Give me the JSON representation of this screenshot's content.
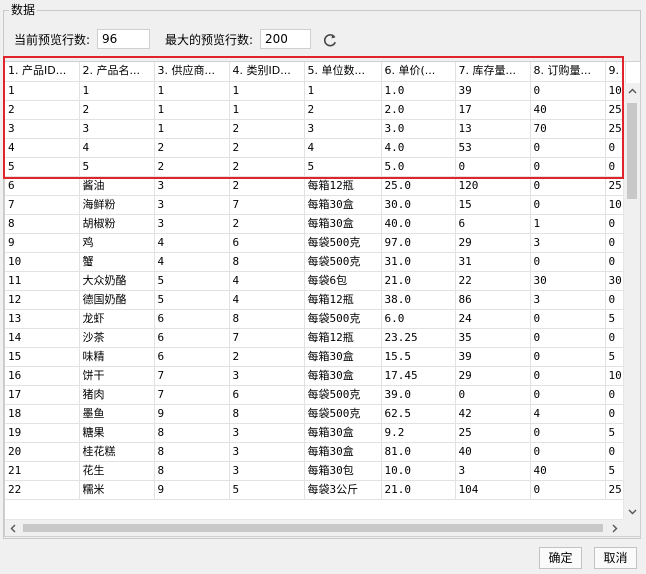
{
  "group": {
    "title": "数据"
  },
  "preview": {
    "current_label": "当前预览行数:",
    "current_value": "96",
    "max_label": "最大的预览行数:",
    "max_value": "200",
    "refresh_icon": "refresh-icon"
  },
  "table": {
    "columns": [
      "1. 产品ID...",
      "2. 产品名...",
      "3. 供应商...",
      "4. 类别ID...",
      "5. 单位数...",
      "6. 单价(...",
      "7. 库存量...",
      "8. 订购量...",
      "9."
    ],
    "rows": [
      [
        "1",
        "1",
        "1",
        "1",
        "1",
        "1.0",
        "39",
        "0",
        "10"
      ],
      [
        "2",
        "2",
        "1",
        "1",
        "2",
        "2.0",
        "17",
        "40",
        "25"
      ],
      [
        "3",
        "3",
        "1",
        "2",
        "3",
        "3.0",
        "13",
        "70",
        "25"
      ],
      [
        "4",
        "4",
        "2",
        "2",
        "4",
        "4.0",
        "53",
        "0",
        "0"
      ],
      [
        "5",
        "5",
        "2",
        "2",
        "5",
        "5.0",
        "0",
        "0",
        "0"
      ],
      [
        "6",
        "酱油",
        "3",
        "2",
        "每箱12瓶",
        "25.0",
        "120",
        "0",
        "25"
      ],
      [
        "7",
        "海鲜粉",
        "3",
        "7",
        "每箱30盒",
        "30.0",
        "15",
        "0",
        "10"
      ],
      [
        "8",
        "胡椒粉",
        "3",
        "2",
        "每箱30盒",
        "40.0",
        "6",
        "1",
        "0"
      ],
      [
        "9",
        "鸡",
        "4",
        "6",
        "每袋500克",
        "97.0",
        "29",
        "3",
        "0"
      ],
      [
        "10",
        "蟹",
        "4",
        "8",
        "每袋500克",
        "31.0",
        "31",
        "0",
        "0"
      ],
      [
        "11",
        "大众奶酪",
        "5",
        "4",
        "每袋6包",
        "21.0",
        "22",
        "30",
        "30"
      ],
      [
        "12",
        "德国奶酪",
        "5",
        "4",
        "每箱12瓶",
        "38.0",
        "86",
        "3",
        "0"
      ],
      [
        "13",
        "龙虾",
        "6",
        "8",
        "每袋500克",
        "6.0",
        "24",
        "0",
        "5"
      ],
      [
        "14",
        "沙茶",
        "6",
        "7",
        "每箱12瓶",
        "23.25",
        "35",
        "0",
        "0"
      ],
      [
        "15",
        "味精",
        "6",
        "2",
        "每箱30盒",
        "15.5",
        "39",
        "0",
        "5"
      ],
      [
        "16",
        "饼干",
        "7",
        "3",
        "每箱30盒",
        "17.45",
        "29",
        "0",
        "10"
      ],
      [
        "17",
        "猪肉",
        "7",
        "6",
        "每袋500克",
        "39.0",
        "0",
        "0",
        "0"
      ],
      [
        "18",
        "墨鱼",
        "9",
        "8",
        "每袋500克",
        "62.5",
        "42",
        "4",
        "0"
      ],
      [
        "19",
        "糖果",
        "8",
        "3",
        "每箱30盒",
        "9.2",
        "25",
        "0",
        "5"
      ],
      [
        "20",
        "桂花糕",
        "8",
        "3",
        "每箱30盒",
        "81.0",
        "40",
        "0",
        "0"
      ],
      [
        "21",
        "花生",
        "8",
        "3",
        "每箱30包",
        "10.0",
        "3",
        "40",
        "5"
      ],
      [
        "22",
        "糯米",
        "9",
        "5",
        "每袋3公斤",
        "21.0",
        "104",
        "0",
        "25"
      ]
    ]
  },
  "highlight": {
    "color": "#e0242c"
  },
  "buttons": {
    "ok": "确定",
    "cancel": "取消"
  }
}
